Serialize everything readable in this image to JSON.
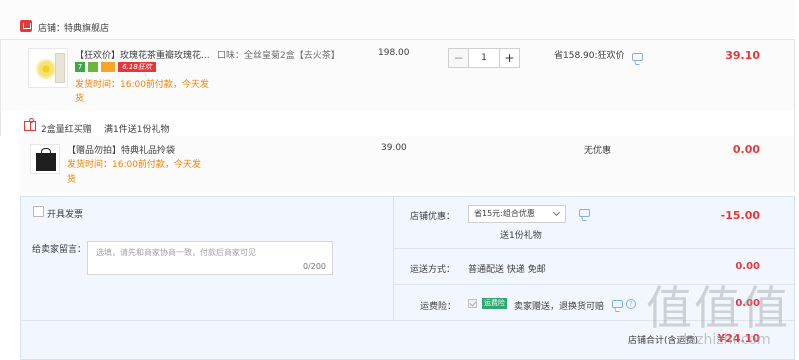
{
  "store": {
    "label": "店铺：",
    "name": "特典旗舰店"
  },
  "product": {
    "title": "【狂欢价】玫瑰花茶重瓣玫瑰花...",
    "flavor": "口味：全丝皇菊2盒【去火茶】",
    "badges": [
      "7",
      "",
      "",
      "6.18狂欢"
    ],
    "shipping_note_line1": "发货时间：16:00前付款，今天发",
    "shipping_note_line2": "货",
    "unit_price": "198.00",
    "quantity": "1",
    "minus": "−",
    "plus": "+",
    "saving": "省158.90:狂欢价",
    "subtotal": "39.10"
  },
  "gift_header": {
    "label": "2盒量红买赠",
    "rule": "满1件送1份礼物"
  },
  "gift_item": {
    "title": "【赠品勿拍】特典礼品拎袋",
    "shipping_note_line1": "发货时间：16:00前付款，今天发",
    "shipping_note_line2": "货",
    "unit_price": "39.00",
    "discount_note": "无优惠",
    "subtotal": "0.00"
  },
  "invoice": {
    "label": "开具发票"
  },
  "message": {
    "label": "给卖家留言：",
    "placeholder": "选填，请先和商家协商一致，付款后商家可见",
    "counter": "0/200"
  },
  "store_coupon": {
    "label": "店铺优惠：",
    "selected": "省15元:组合优惠",
    "gift_note": "送1份礼物",
    "amount": "-15.00"
  },
  "delivery": {
    "label": "运送方式：",
    "value": "普通配送 快递 免邮",
    "amount": "0.00"
  },
  "insurance": {
    "label": "运费险：",
    "tag": "运费险",
    "value": "卖家赠送，退换货可赔",
    "amount": "0.00"
  },
  "total": {
    "label": "店铺合计(含运费)",
    "amount": "¥24.10"
  },
  "watermark": {
    "glyphs": "值值值",
    "url": "zhizhizhi.com"
  },
  "colors": {
    "accent_red": "#e4393c",
    "accent_orange": "#f08200",
    "panel_blue": "#f2f7ff"
  }
}
